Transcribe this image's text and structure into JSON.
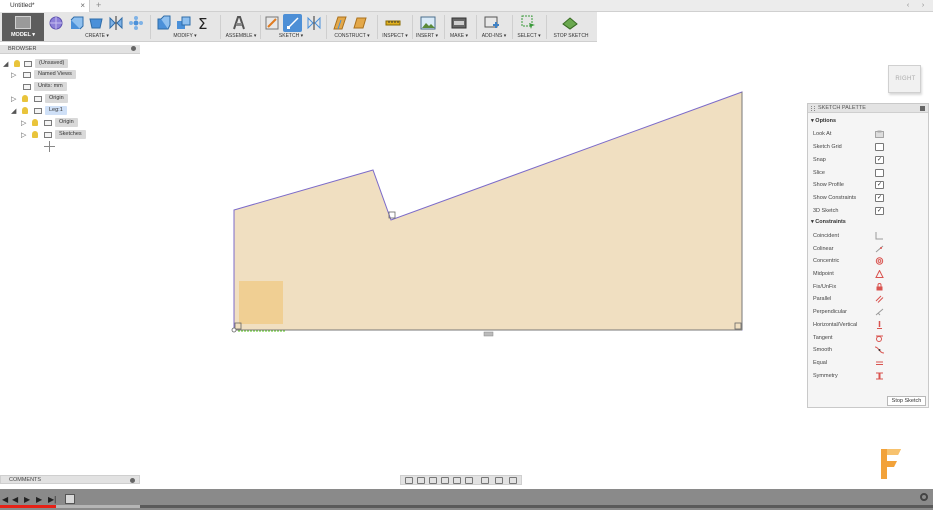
{
  "document": {
    "tab_title": "Untitled*"
  },
  "toolbar": {
    "workspace_label": "MODEL ▾",
    "groups": [
      {
        "label": "CREATE ▾"
      },
      {
        "label": "MODIFY ▾"
      },
      {
        "label": "ASSEMBLE ▾"
      },
      {
        "label": "SKETCH ▾"
      },
      {
        "label": "CONSTRUCT ▾"
      },
      {
        "label": "INSPECT ▾"
      },
      {
        "label": "INSERT ▾"
      },
      {
        "label": "MAKE ▾"
      },
      {
        "label": "ADD-INS ▾"
      },
      {
        "label": "SELECT ▾"
      },
      {
        "label": "STOP SKETCH"
      }
    ]
  },
  "browser": {
    "title": "BROWSER",
    "items": [
      {
        "label": "(Unsaved)"
      },
      {
        "label": "Named Views"
      },
      {
        "label": "Units: mm"
      },
      {
        "label": "Origin"
      },
      {
        "label": "Leg:1"
      },
      {
        "label": "Origin"
      },
      {
        "label": "Sketches"
      }
    ]
  },
  "viewcube": {
    "label": "RIGHT"
  },
  "palette": {
    "title": "SKETCH PALETTE",
    "options_header": "Options",
    "options": [
      {
        "label": "Look At",
        "control": "look-at-icon"
      },
      {
        "label": "Sketch Grid",
        "checked": false
      },
      {
        "label": "Snap",
        "checked": true
      },
      {
        "label": "Slice",
        "checked": false
      },
      {
        "label": "Show Profile",
        "checked": true
      },
      {
        "label": "Show Constraints",
        "checked": true
      },
      {
        "label": "3D Sketch",
        "checked": true
      }
    ],
    "constraints_header": "Constraints",
    "constraints": [
      {
        "label": "Coincident",
        "icon": "coincident-icon",
        "color": "#9a9a9a"
      },
      {
        "label": "Colinear",
        "icon": "colinear-icon",
        "color": "#9a9a9a"
      },
      {
        "label": "Concentric",
        "icon": "concentric-icon",
        "color": "#d9534f"
      },
      {
        "label": "Midpoint",
        "icon": "midpoint-icon",
        "color": "#d9534f"
      },
      {
        "label": "Fix/UnFix",
        "icon": "lock-icon",
        "color": "#d9534f"
      },
      {
        "label": "Parallel",
        "icon": "parallel-icon",
        "color": "#d9534f"
      },
      {
        "label": "Perpendicular",
        "icon": "perpendicular-icon",
        "color": "#9a9a9a"
      },
      {
        "label": "Horizontal/Vertical",
        "icon": "horizontal-vertical-icon",
        "color": "#d9534f"
      },
      {
        "label": "Tangent",
        "icon": "tangent-icon",
        "color": "#d9534f"
      },
      {
        "label": "Smooth",
        "icon": "smooth-icon",
        "color": "#d9534f"
      },
      {
        "label": "Equal",
        "icon": "equal-icon",
        "color": "#d9534f"
      },
      {
        "label": "Symmetry",
        "icon": "symmetry-icon",
        "color": "#d9534f"
      }
    ],
    "stop_button": "Stop Sketch"
  },
  "comments": {
    "title": "COMMENTS"
  },
  "video": {
    "progress_fraction": 0.06,
    "buffered_fraction": 0.15
  },
  "colors": {
    "accent": "#3f82c6",
    "profile_fill": "#f0dfc1",
    "sketch_line": "#7c6bc9",
    "progress": "#e62117",
    "logo": "#f2a23a"
  }
}
